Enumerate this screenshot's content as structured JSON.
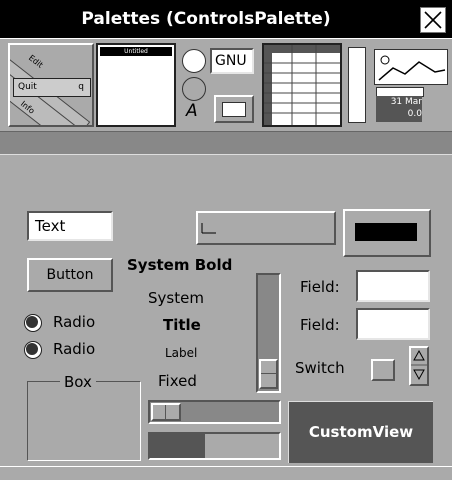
{
  "window": {
    "title": "Palettes (ControlsPalette)"
  },
  "palette_strip": {
    "menu_thumb": {
      "item_1": "Quit",
      "item_2": "q",
      "item_3": "Edit",
      "item_4": "Info"
    },
    "window_thumb": {
      "title": "Untitled"
    },
    "popup_thumb": {
      "label": "GNU",
      "letter": "A"
    },
    "image_thumb": {
      "date": "31 Mar",
      "time": "0.0"
    }
  },
  "controls": {
    "text_field_value": "Text",
    "button_label": "Button",
    "radio_1": "Radio",
    "radio_2": "Radio",
    "box_title": "Box",
    "font_system_bold": "System Bold",
    "font_system": "System",
    "font_title": "Title",
    "font_label": "Label",
    "font_fixed": "Fixed",
    "field_label_1": "Field:",
    "field_label_2": "Field:",
    "switch_label": "Switch",
    "custom_view_label": "CustomView"
  },
  "progress": {
    "fraction": 0.43
  },
  "colors": {
    "custom_view_bg": "#555555",
    "titlebar_bg": "#000000",
    "window_bg": "#aaaaaa"
  }
}
